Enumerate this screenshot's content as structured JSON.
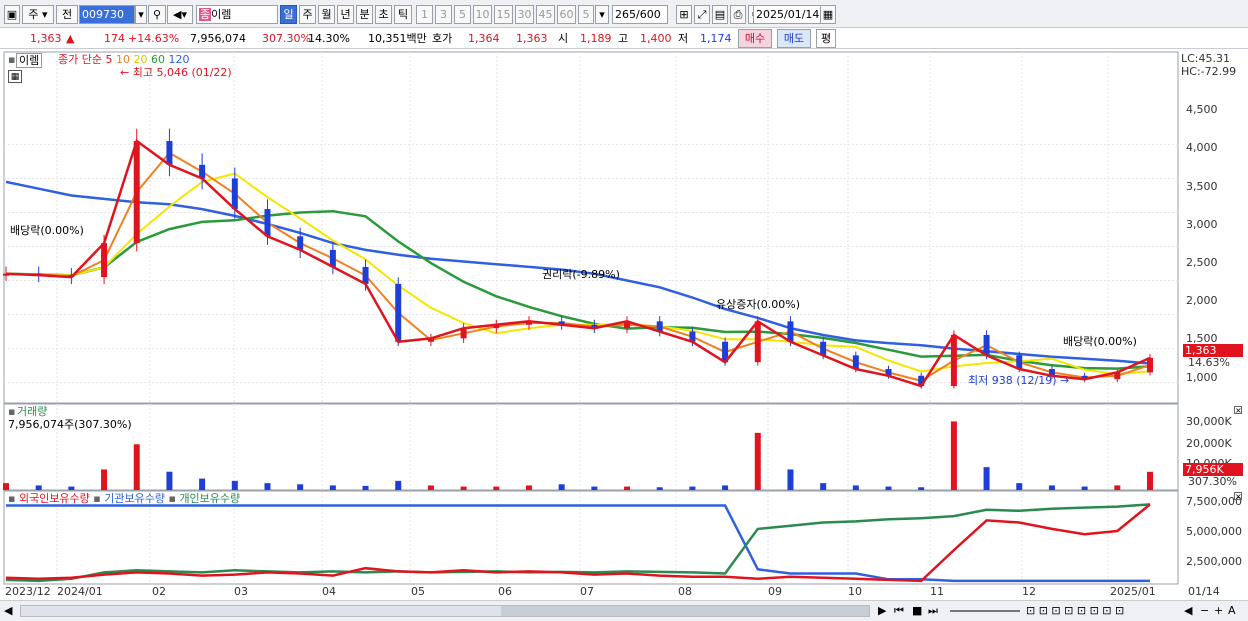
{
  "toolbar": {
    "market": "주",
    "period_prefix": "전",
    "code": "009730",
    "name": "이렘",
    "name_prefix": "종",
    "intervals": [
      "일",
      "주",
      "월",
      "년",
      "분",
      "초",
      "틱"
    ],
    "minute_opts": [
      "1",
      "3",
      "5",
      "10",
      "15",
      "30",
      "45",
      "60"
    ],
    "unit_value": "5",
    "count": "265",
    "count_total": "/600",
    "date": "2025/01/14"
  },
  "quote": {
    "price": "1,363",
    "change_arrow": "▲",
    "change": "174",
    "change_pct": "+14.63%",
    "volume": "7,956,074",
    "vol_ratio": "307.30%",
    "turnover": "14.30%",
    "amount": "10,351백만",
    "bid_label": "호가",
    "ask": "1,364",
    "bid": "1,363",
    "open_label": "시",
    "open": "1,189",
    "high_label": "고",
    "high": "1,400",
    "low_label": "저",
    "low": "1,174",
    "buy": "매수",
    "sell": "매도",
    "avg": "평"
  },
  "price_panel": {
    "name": "이렘",
    "legend_prefix": "종가 단순",
    "ma_periods": [
      "5",
      "10",
      "20",
      "60",
      "120"
    ],
    "lc": "LC:45.31",
    "hc": "HC:-72.99",
    "current_tag": "1,363",
    "current_pct": "14.63%",
    "y_ticks": [
      "4,500",
      "4,000",
      "3,500",
      "3,000",
      "2,500",
      "2,000",
      "1,500",
      "1,000"
    ],
    "annotations": {
      "high": "최고 5,046 (01/22)",
      "low": "최저 938 (12/19)",
      "div1": "배당락(0.00%)",
      "rights": "권리락(-9.89%)",
      "bonus": "유상증자(0.00%)",
      "div2": "배당락(0.00%)"
    }
  },
  "volume_panel": {
    "title": "거래량",
    "value": "7,956,074주(307.30%)",
    "y_ticks": [
      "30,000K",
      "20,000K",
      "10,000K"
    ],
    "current_tag": "7,956K",
    "current_pct": "307.30%"
  },
  "holdings_panel": {
    "legend": [
      "외국인보유수량",
      "기관보유수량",
      "개인보유수량"
    ],
    "y_ticks": [
      "7,500,000",
      "5,000,000",
      "2,500,000"
    ]
  },
  "x_axis": {
    "labels": [
      "2023/12",
      "2024/01",
      "02",
      "03",
      "04",
      "05",
      "06",
      "07",
      "08",
      "09",
      "10",
      "11",
      "12",
      "2025/01"
    ],
    "right_label": "01/14"
  },
  "colors": {
    "up": "#e0141e",
    "down": "#1e3ed8",
    "ma5": "#e0141e",
    "ma10": "#f08020",
    "ma20": "#f5e600",
    "ma60": "#2a9a3a",
    "ma120": "#3060e0",
    "foreign": "#e0141e",
    "inst": "#3060e0",
    "indiv": "#2a8a50"
  },
  "chart_data": [
    {
      "type": "line",
      "title": "이렘",
      "series": [
        {
          "name": "5",
          "values": [
            2600,
            2580,
            2550,
            3050,
            4550,
            4200,
            4000,
            3550,
            3150,
            2950,
            2700,
            2450,
            1600,
            1650,
            1800,
            1850,
            1900,
            1850,
            1800,
            1900,
            1750,
            1600,
            1300,
            1900,
            1600,
            1400,
            1200,
            1100,
            950,
            1700,
            1400,
            1200,
            1100,
            1050,
            1150,
            1363
          ]
        },
        {
          "name": "120",
          "values": [
            3950,
            3850,
            3750,
            3700,
            3650,
            3620,
            3550,
            3450,
            3330,
            3200,
            3050,
            2950,
            2880,
            2820,
            2780,
            2740,
            2700,
            2660,
            2600,
            2500,
            2400,
            2250,
            2080,
            1950,
            1800,
            1700,
            1620,
            1580,
            1550,
            1500,
            1460,
            1420,
            1380,
            1350,
            1320,
            1280
          ]
        }
      ],
      "ylim": [
        700,
        5300
      ]
    },
    {
      "type": "bar",
      "title": "거래량",
      "ylim": [
        0,
        35000
      ]
    },
    {
      "type": "line",
      "series": [
        {
          "name": "외국인보유수량"
        },
        {
          "name": "기관보유수량"
        },
        {
          "name": "개인보유수량"
        }
      ],
      "ylim": [
        0,
        8000000
      ]
    }
  ]
}
